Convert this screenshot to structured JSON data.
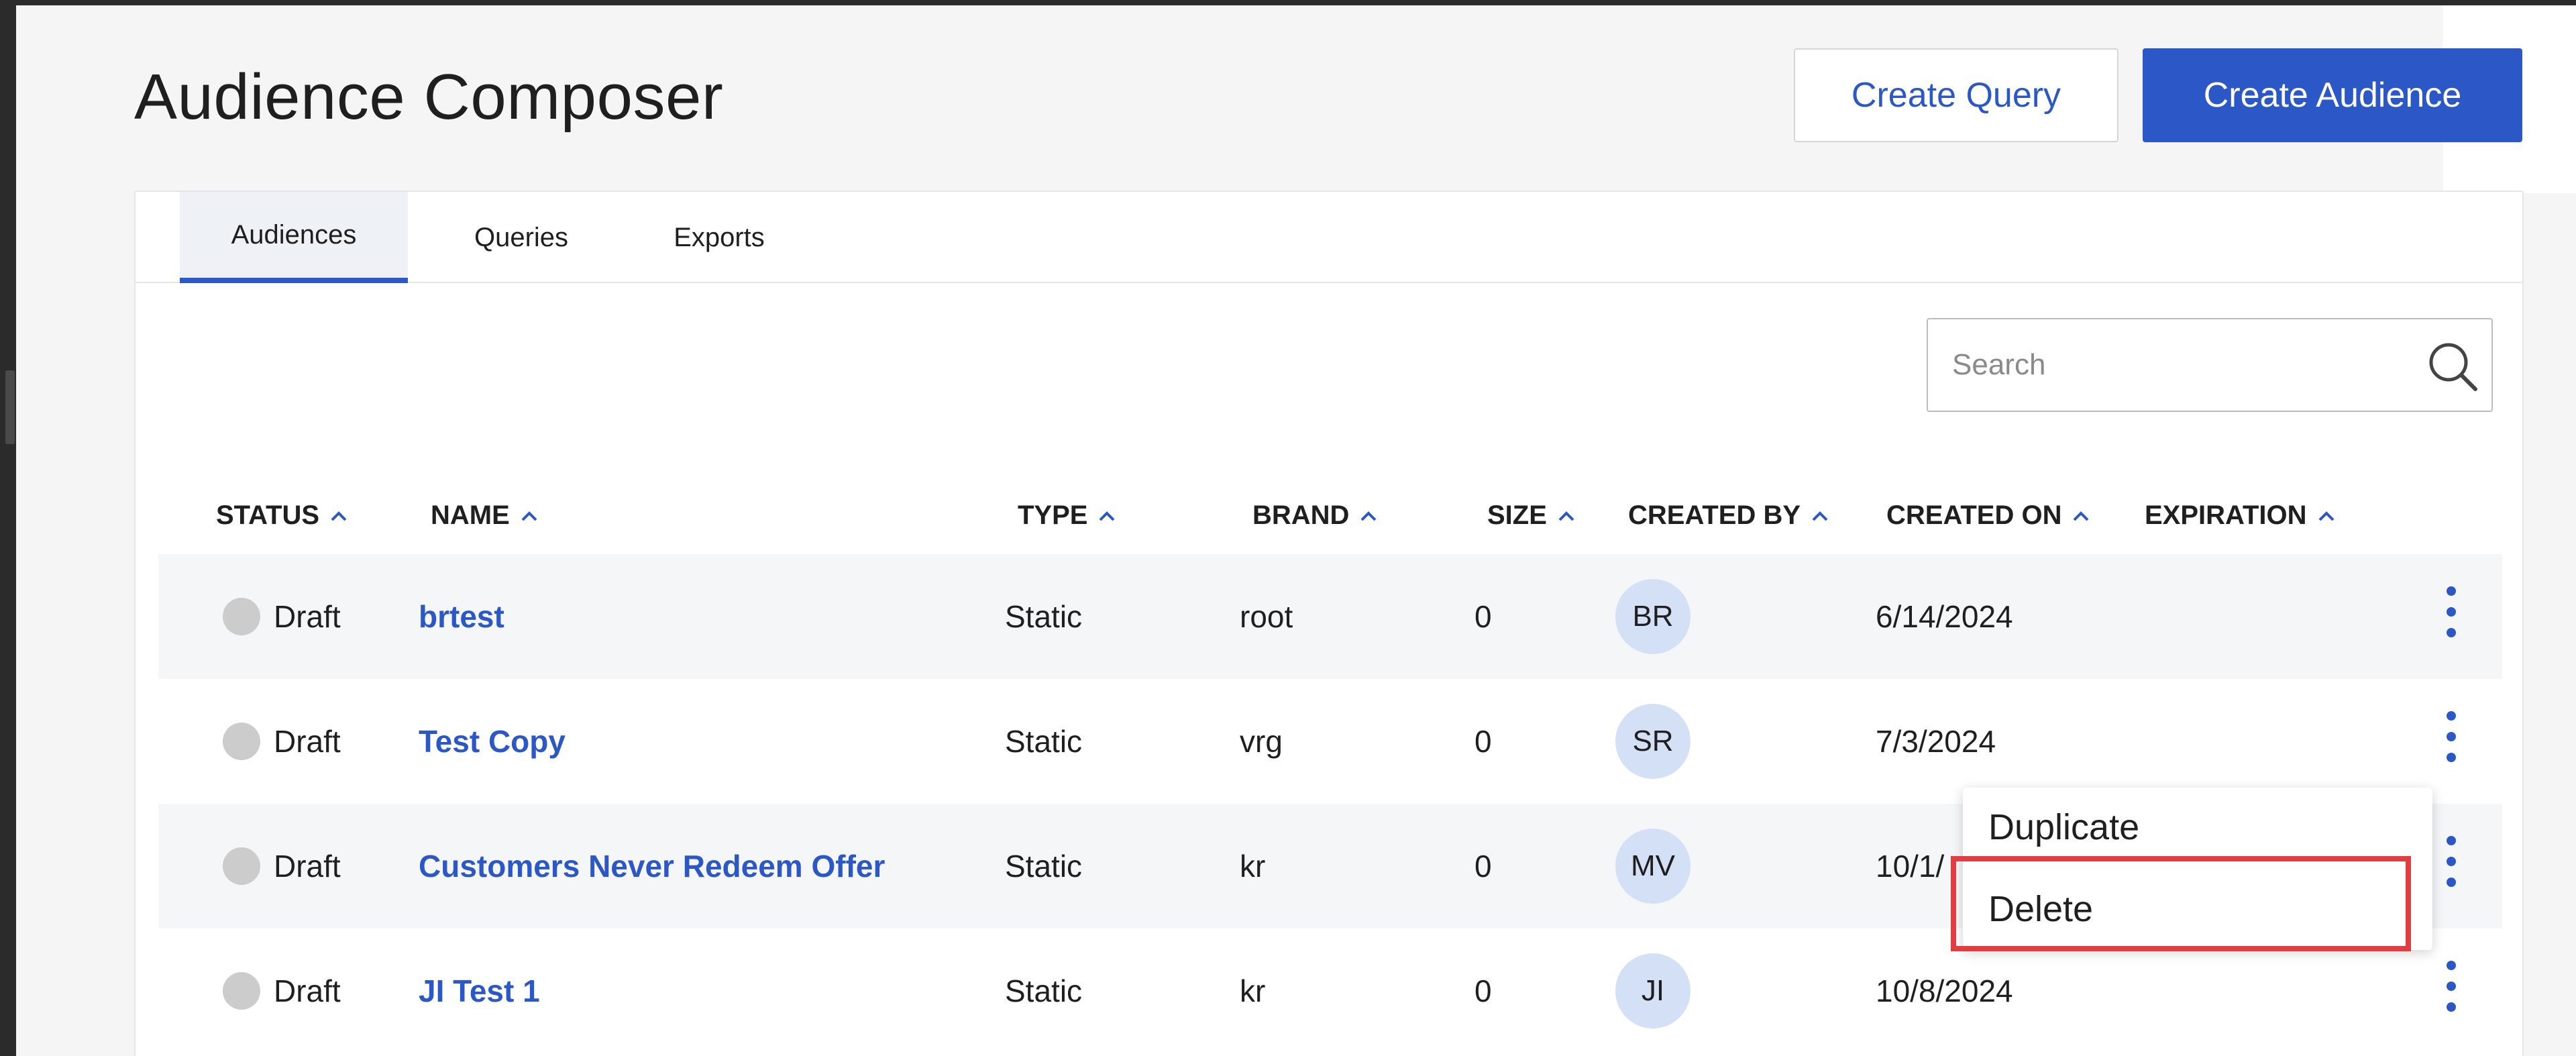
{
  "page": {
    "title": "Audience Composer"
  },
  "header": {
    "create_query_label": "Create Query",
    "create_audience_label": "Create Audience"
  },
  "tabs": [
    {
      "label": "Audiences",
      "active": true
    },
    {
      "label": "Queries",
      "active": false
    },
    {
      "label": "Exports",
      "active": false
    }
  ],
  "search": {
    "placeholder": "Search",
    "value": ""
  },
  "table": {
    "columns": [
      "STATUS",
      "NAME",
      "TYPE",
      "BRAND",
      "SIZE",
      "CREATED BY",
      "CREATED ON",
      "EXPIRATION"
    ],
    "rows": [
      {
        "status": "Draft",
        "name": "brtest",
        "type": "Static",
        "brand": "root",
        "size": "0",
        "created_by": "BR",
        "created_on": "6/14/2024",
        "expiration": ""
      },
      {
        "status": "Draft",
        "name": "Test Copy",
        "type": "Static",
        "brand": "vrg",
        "size": "0",
        "created_by": "SR",
        "created_on": "7/3/2024",
        "expiration": ""
      },
      {
        "status": "Draft",
        "name": "Customers Never Redeem Offer",
        "type": "Static",
        "brand": "kr",
        "size": "0",
        "created_by": "MV",
        "created_on": "10/1/",
        "expiration": ""
      },
      {
        "status": "Draft",
        "name": "JI Test 1",
        "type": "Static",
        "brand": "kr",
        "size": "0",
        "created_by": "JI",
        "created_on": "10/8/2024",
        "expiration": ""
      }
    ]
  },
  "context_menu": {
    "items": [
      "Duplicate",
      "Delete"
    ],
    "highlighted": "Delete"
  },
  "colors": {
    "accent": "#2c57c7",
    "avatar_bg": "#d4e0f5",
    "status_dot": "#cccccc",
    "highlight": "#e33d44"
  },
  "icons": {
    "search": "search-icon",
    "sort": "chevron-up-icon",
    "row_menu": "kebab-menu-icon"
  }
}
